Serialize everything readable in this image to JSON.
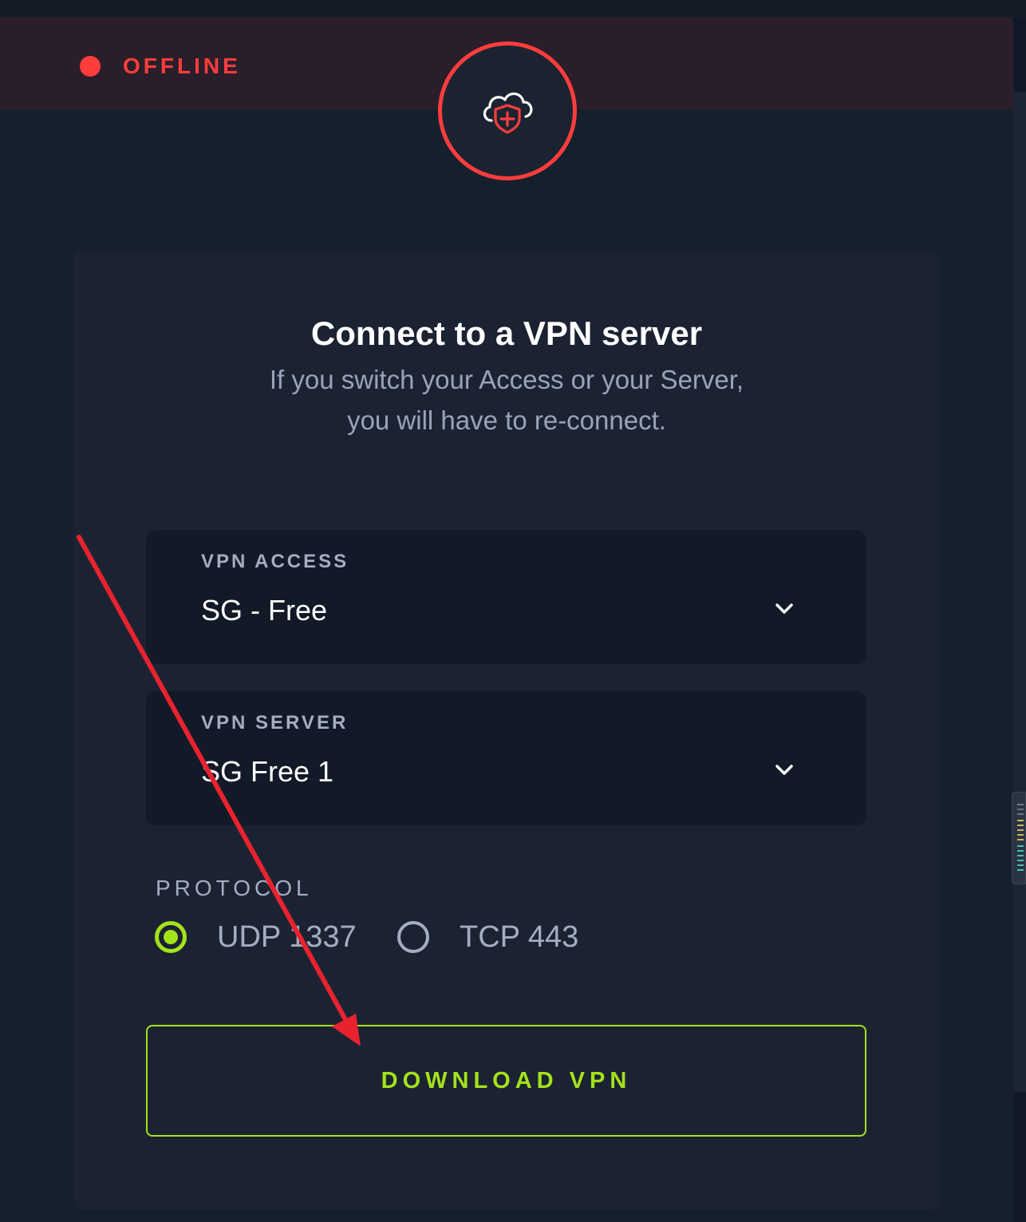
{
  "status": {
    "text": "OFFLINE",
    "color": "#ff3d3d"
  },
  "logo": {
    "icon": "cloud-shield-plus-icon"
  },
  "card": {
    "title": "Connect to a VPN server",
    "subtitle_line1": "If you switch your Access or your Server,",
    "subtitle_line2": "you will have to re-connect."
  },
  "vpn_access": {
    "label": "VPN ACCESS",
    "value": "SG - Free"
  },
  "vpn_server": {
    "label": "VPN SERVER",
    "value": "SG Free 1"
  },
  "protocol": {
    "label": "PROTOCOL",
    "options": [
      {
        "label": "UDP 1337",
        "selected": true
      },
      {
        "label": "TCP 443",
        "selected": false
      }
    ]
  },
  "download_button": {
    "label": "DOWNLOAD VPN"
  },
  "colors": {
    "accent": "#a4e21b",
    "offline": "#ff3d3d",
    "annotation_arrow": "#e8232f"
  }
}
